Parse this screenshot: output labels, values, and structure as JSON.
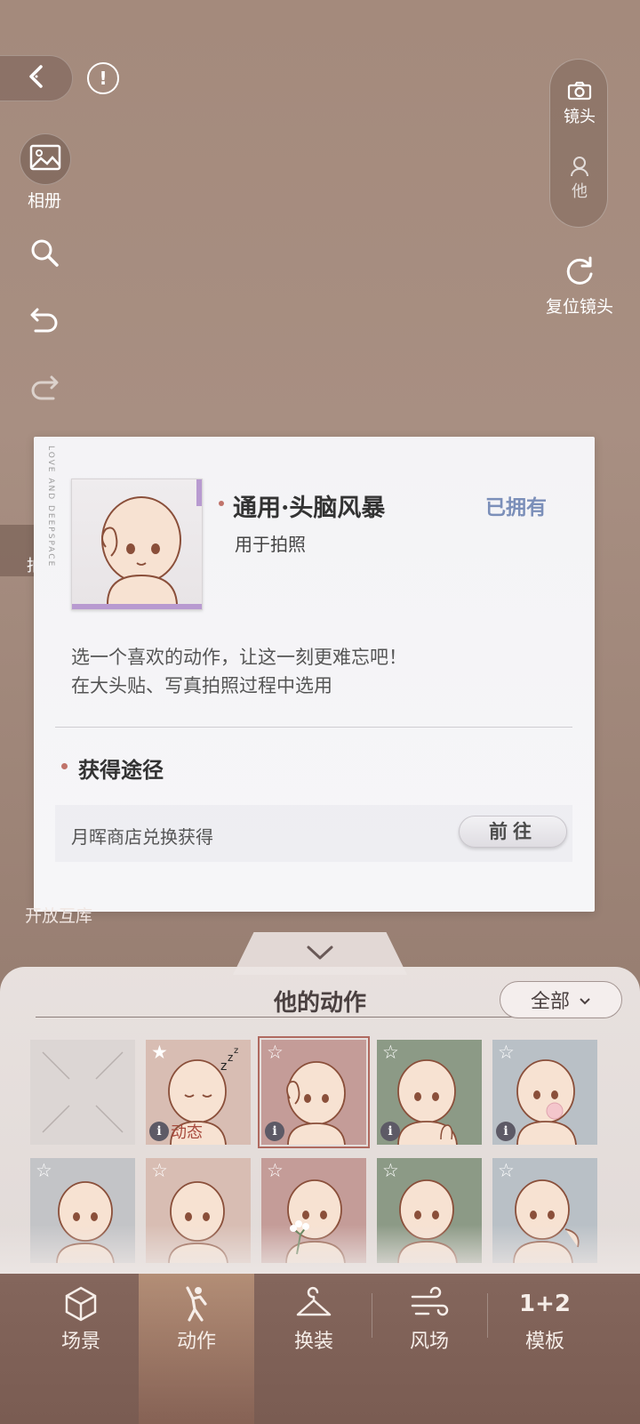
{
  "topbar": {
    "back_icon": "chevron-left-icon",
    "info_icon": "exclamation-circle-icon",
    "info_glyph": "!"
  },
  "left_rail": {
    "album_label": "相册",
    "icons": [
      "image-icon",
      "search-icon",
      "undo-icon",
      "redo-icon"
    ],
    "partial_label": "拍"
  },
  "right_rail": {
    "camera_label": "镜头",
    "him_label": "他",
    "reset_label": "复位镜头"
  },
  "dialog": {
    "deco_text": "LOVE AND DEEPSPACE",
    "title": "通用·头脑风暴",
    "subtitle": "用于拍照",
    "owned": "已拥有",
    "description_line1": "选一个喜欢的动作，让这一刻更难忘吧！",
    "description_line2": "在大头贴、写真拍照过程中选用",
    "obtain_heading": "获得途径",
    "obtain_source": "月晖商店兑换获得",
    "goto_button": "前往"
  },
  "background": {
    "partial_text": "开放互库"
  },
  "panel": {
    "title": "他的动作",
    "filter_label": "全部",
    "row1": [
      {
        "state": "empty"
      },
      {
        "tag": "动态",
        "starred": true,
        "color": "#d8bdb3"
      },
      {
        "starred": false,
        "selected": true,
        "color": "#c49c98"
      },
      {
        "starred": false,
        "color": "#8c9a86"
      },
      {
        "starred": false,
        "color": "#b9c0c6"
      }
    ],
    "row2": [
      {
        "starred": false,
        "color": "#c3c4c7"
      },
      {
        "starred": false,
        "color": "#d8bdb3"
      },
      {
        "starred": false,
        "color": "#c49c98"
      },
      {
        "starred": false,
        "color": "#8c9a86"
      },
      {
        "starred": false,
        "color": "#b9c0c6"
      }
    ]
  },
  "bottom_nav": {
    "items": [
      {
        "label": "场景",
        "icon": "cube-icon"
      },
      {
        "label": "动作",
        "icon": "pose-figure-icon",
        "active": true
      },
      {
        "label": "换装",
        "icon": "hanger-icon"
      },
      {
        "label": "风场",
        "icon": "wind-icon"
      },
      {
        "label": "模板",
        "icon": "template-icon",
        "glyph": "1+2"
      }
    ]
  }
}
